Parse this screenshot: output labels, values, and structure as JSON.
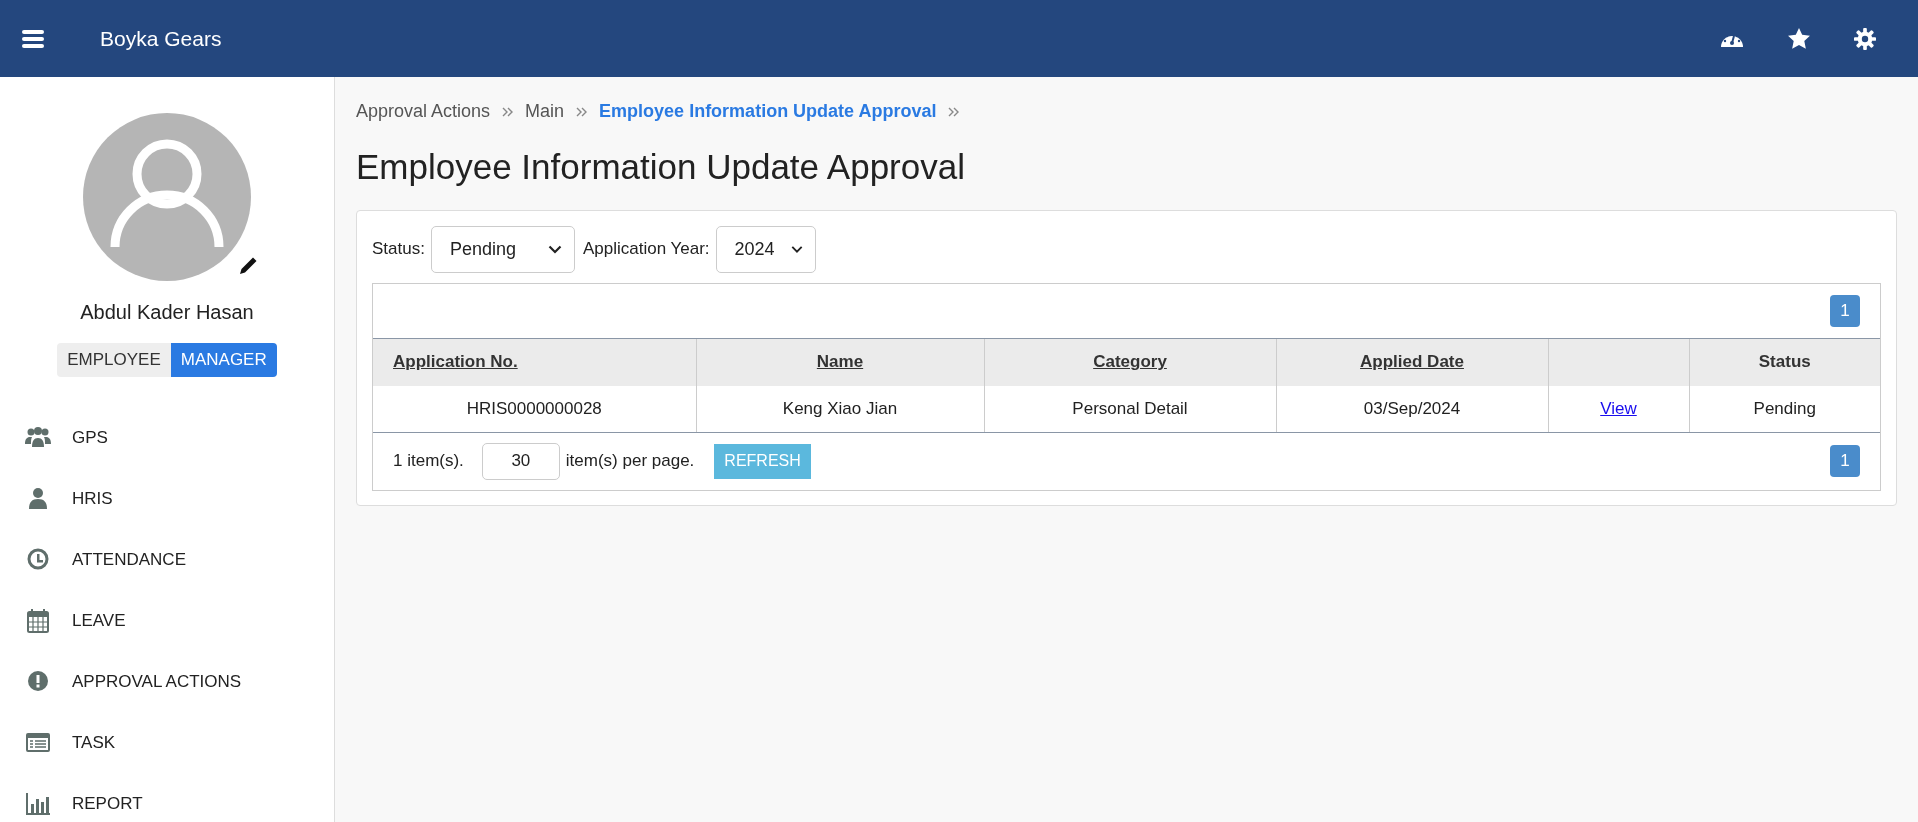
{
  "header": {
    "brand": "Boyka Gears"
  },
  "profile": {
    "name": "Abdul Kader Hasan",
    "roles": [
      {
        "label": "EMPLOYEE",
        "selected": false
      },
      {
        "label": "MANAGER",
        "selected": true
      }
    ]
  },
  "sidebar": {
    "items": [
      {
        "label": "GPS"
      },
      {
        "label": "HRIS"
      },
      {
        "label": "ATTENDANCE"
      },
      {
        "label": "LEAVE"
      },
      {
        "label": "APPROVAL ACTIONS"
      },
      {
        "label": "TASK"
      },
      {
        "label": "REPORT"
      }
    ]
  },
  "breadcrumb": [
    {
      "label": "Approval Actions",
      "current": false
    },
    {
      "label": "Main",
      "current": false
    },
    {
      "label": "Employee Information Update Approval",
      "current": true
    }
  ],
  "page_title": "Employee Information Update Approval",
  "filters": [
    {
      "label": "Status:",
      "value": "Pending"
    },
    {
      "label": "Application Year:",
      "value": "2024"
    }
  ],
  "table": {
    "pager_top": [
      {
        "label": "1",
        "selected": true
      }
    ],
    "columns": [
      {
        "label": "Application No.",
        "sortable": true
      },
      {
        "label": "Name",
        "sortable": true
      },
      {
        "label": "Category",
        "sortable": true
      },
      {
        "label": "Applied Date",
        "sortable": true
      },
      {},
      {
        "label": "Status",
        "sortable": false
      }
    ],
    "rows": [
      [
        {
          "kind": "text",
          "text": "HRIS0000000028"
        },
        {
          "kind": "text",
          "text": "Keng Xiao Jian"
        },
        {
          "kind": "text",
          "text": "Personal Detail"
        },
        {
          "kind": "text",
          "text": "03/Sep/2024"
        },
        {
          "kind": "link",
          "text": "View"
        },
        {
          "kind": "text",
          "text": "Pending"
        }
      ]
    ],
    "footer": {
      "count": "1 item(s).",
      "page_size": "30",
      "per_page": "item(s) per page.",
      "refresh": "REFRESH"
    },
    "pager_bottom": [
      {
        "label": "1",
        "selected": true
      }
    ]
  }
}
